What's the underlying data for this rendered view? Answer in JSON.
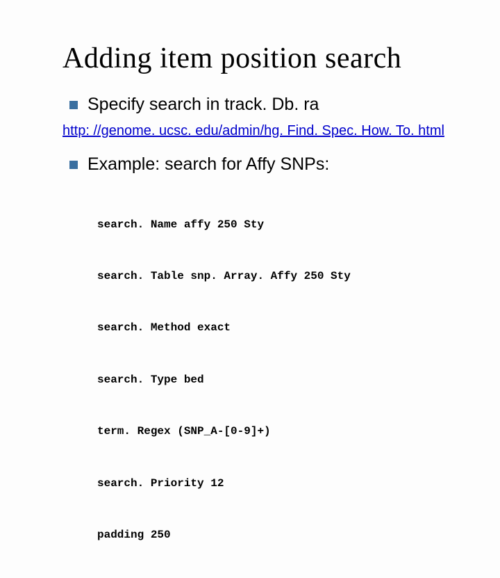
{
  "title": "Adding item position search",
  "bullets": [
    {
      "text": "Specify search in track. Db. ra"
    },
    {
      "text": "Example: search for Affy SNPs:"
    }
  ],
  "link": "http: //genome. ucsc. edu/admin/hg. Find. Spec. How. To. html",
  "code": [
    "search. Name affy 250 Sty",
    "search. Table snp. Array. Affy 250 Sty",
    "search. Method exact",
    "search. Type bed",
    "term. Regex (SNP_A-[0-9]+)",
    "search. Priority 12",
    "padding 250"
  ]
}
